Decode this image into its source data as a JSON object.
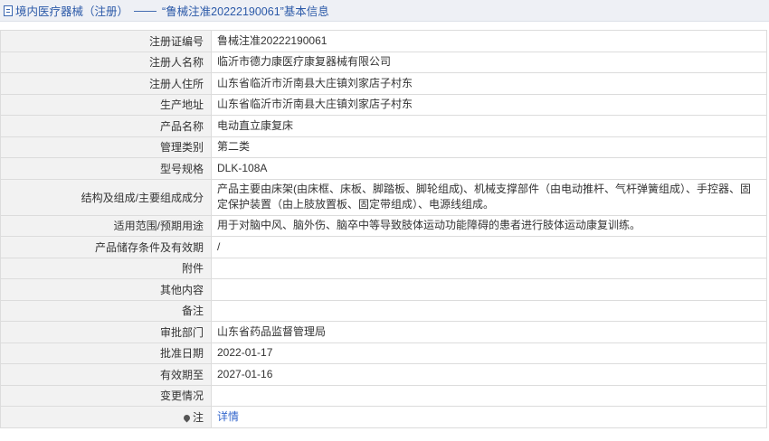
{
  "header": {
    "icon": "document-icon",
    "category": "境内医疗器械（注册）",
    "separator": "——",
    "title": "“鲁械注准20222190061”基本信息"
  },
  "rows": [
    {
      "label": "注册证编号",
      "value": "鲁械注准20222190061"
    },
    {
      "label": "注册人名称",
      "value": "临沂市德力康医疗康复器械有限公司"
    },
    {
      "label": "注册人住所",
      "value": "山东省临沂市沂南县大庄镇刘家店子村东"
    },
    {
      "label": "生产地址",
      "value": "山东省临沂市沂南县大庄镇刘家店子村东"
    },
    {
      "label": "产品名称",
      "value": "电动直立康复床"
    },
    {
      "label": "管理类别",
      "value": "第二类"
    },
    {
      "label": "型号规格",
      "value": "DLK-108A"
    },
    {
      "label": "结构及组成/主要组成成分",
      "value": "产品主要由床架(由床框、床板、脚踏板、脚轮组成)、机械支撑部件（由电动推杆、气杆弹簧组成）、手控器、固定保护装置（由上肢放置板、固定带组成）、电源线组成。"
    },
    {
      "label": "适用范围/预期用途",
      "value": "用于对脑中风、脑外伤、脑卒中等导致肢体运动功能障碍的患者进行肢体运动康复训练。"
    },
    {
      "label": "产品储存条件及有效期",
      "value": "/"
    },
    {
      "label": "附件",
      "value": ""
    },
    {
      "label": "其他内容",
      "value": ""
    },
    {
      "label": "备注",
      "value": ""
    },
    {
      "label": "审批部门",
      "value": "山东省药品监督管理局"
    },
    {
      "label": "批准日期",
      "value": "2022-01-17"
    },
    {
      "label": "有效期至",
      "value": "2027-01-16"
    },
    {
      "label": "变更情况",
      "value": ""
    }
  ],
  "note": {
    "icon": "pin-icon",
    "label": "注",
    "link": "详情"
  }
}
